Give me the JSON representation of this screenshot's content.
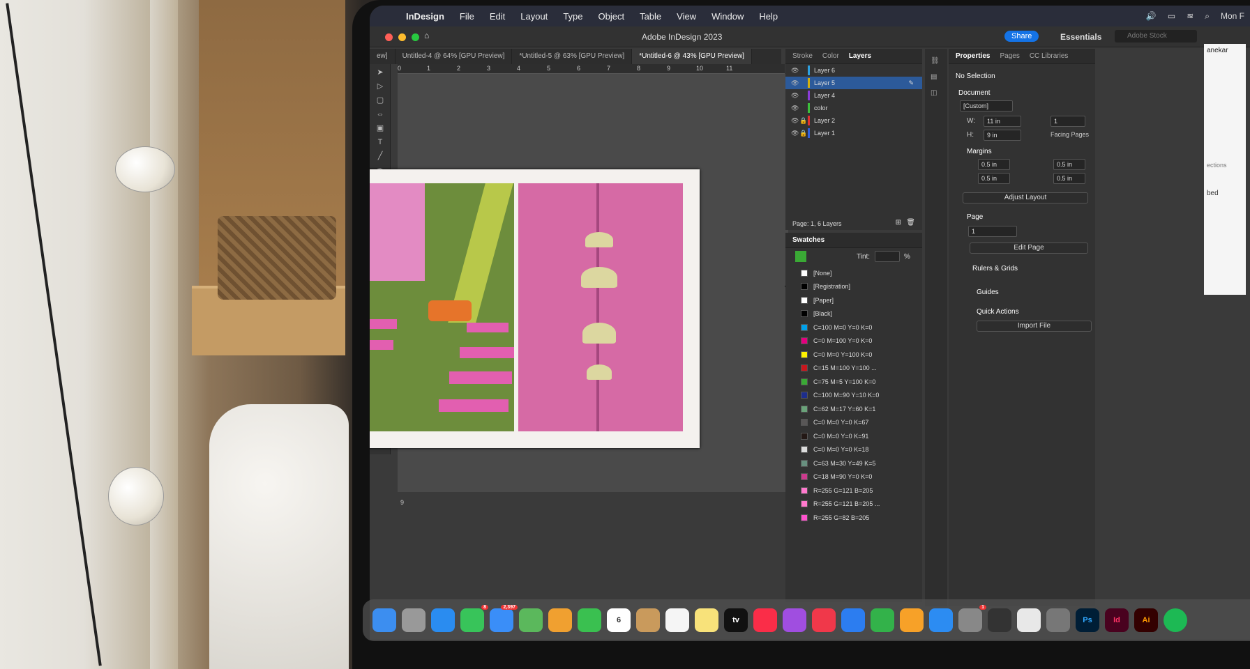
{
  "menubar": {
    "items": [
      "InDesign",
      "File",
      "Edit",
      "Layout",
      "Type",
      "Object",
      "Table",
      "View",
      "Window",
      "Help"
    ],
    "right": [
      "Mon F"
    ]
  },
  "window": {
    "title": "Adobe InDesign 2023",
    "share_label": "Share",
    "workspace_label": "Essentials",
    "stock_placeholder": "Adobe Stock"
  },
  "tabs": [
    {
      "label": "ew]"
    },
    {
      "label": "Untitled-4 @ 64% [GPU Preview]"
    },
    {
      "label": "*Untitled-5 @ 63% [GPU Preview]"
    },
    {
      "label": "*Untitled-6 @ 43% [GPU Preview]"
    }
  ],
  "ruler": {
    "ticks": [
      "0",
      "1",
      "2",
      "3",
      "4",
      "5",
      "6",
      "7",
      "8",
      "9",
      "10",
      "11"
    ],
    "side_label": "9"
  },
  "layers_panel": {
    "tabs": [
      "Stroke",
      "Color",
      "Layers"
    ],
    "layers": [
      {
        "name": "Layer 6",
        "color": "#2ea0e0"
      },
      {
        "name": "Layer 5",
        "color": "#d2b00f"
      },
      {
        "name": "Layer 4",
        "color": "#8a3cd6"
      },
      {
        "name": "color",
        "color": "#3cbf3c"
      },
      {
        "name": "Layer 2",
        "color": "#e03030"
      },
      {
        "name": "Layer 1",
        "color": "#3060e0"
      }
    ],
    "footer": "Page: 1, 6 Layers"
  },
  "swatches_panel": {
    "title": "Swatches",
    "tint_label": "Tint:",
    "tint_unit": "%",
    "swatches": [
      {
        "name": "[None]",
        "color": "#ffffff"
      },
      {
        "name": "[Registration]",
        "color": "#000000"
      },
      {
        "name": "[Paper]",
        "color": "#ffffff"
      },
      {
        "name": "[Black]",
        "color": "#000000"
      },
      {
        "name": "C=100 M=0 Y=0 K=0",
        "color": "#00a0e9"
      },
      {
        "name": "C=0 M=100 Y=0 K=0",
        "color": "#e4007f"
      },
      {
        "name": "C=0 M=0 Y=100 K=0",
        "color": "#fff100"
      },
      {
        "name": "C=15 M=100 Y=100 ...",
        "color": "#c8161d"
      },
      {
        "name": "C=75 M=5 Y=100 K=0",
        "color": "#3aa935"
      },
      {
        "name": "C=100 M=90 Y=10 K=0",
        "color": "#1d2d8c"
      },
      {
        "name": "C=62 M=17 Y=60 K=1",
        "color": "#6aa37a"
      },
      {
        "name": "C=0 M=0 Y=0 K=67",
        "color": "#595757"
      },
      {
        "name": "C=0 M=0 Y=0 K=91",
        "color": "#231815"
      },
      {
        "name": "C=0 M=0 Y=0 K=18",
        "color": "#dcdddd"
      },
      {
        "name": "C=63 M=30 Y=49 K=5",
        "color": "#68907f"
      },
      {
        "name": "C=18 M=90 Y=0 K=0",
        "color": "#cc3a8d"
      },
      {
        "name": "R=255 G=121 B=205",
        "color": "#ff79cd"
      },
      {
        "name": "R=255 G=121 B=205 ...",
        "color": "#ff79cd"
      },
      {
        "name": "R=255 G=82 B=205",
        "color": "#ff52cd"
      }
    ]
  },
  "properties_panel": {
    "tabs": [
      "Properties",
      "Pages",
      "CC Libraries"
    ],
    "selection": "No Selection",
    "document_label": "Document",
    "preset": "[Custom]",
    "width_label": "W:",
    "width": "11 in",
    "height_label": "H:",
    "height": "9 in",
    "pages_count": "1",
    "facing_pages": "Facing Pages",
    "margins_label": "Margins",
    "margin_top": "0.5 in",
    "margin_bottom": "0.5 in",
    "margin_left": "0.5 in",
    "margin_right": "0.5 in",
    "adjust_layout": "Adjust Layout",
    "page_label": "Page",
    "page_value": "1",
    "edit_page": "Edit Page",
    "rulers_grids": "Rulers & Grids",
    "guides": "Guides",
    "quick_actions": "Quick Actions",
    "import_file": "Import File"
  },
  "dock": {
    "apps": [
      {
        "name": "Finder",
        "color": "#3c8ef0"
      },
      {
        "name": "Launchpad",
        "color": "#999"
      },
      {
        "name": "Safari",
        "color": "#2a8cf0"
      },
      {
        "name": "Messages",
        "color": "#38c45a",
        "badge": "8"
      },
      {
        "name": "Mail",
        "color": "#3a8ef8",
        "badge": "2,397"
      },
      {
        "name": "Maps",
        "color": "#5bb85c"
      },
      {
        "name": "Photos",
        "color": "#f0a030"
      },
      {
        "name": "FaceTime",
        "color": "#3ac050"
      },
      {
        "name": "Calendar",
        "color": "#ffffff",
        "text": "6"
      },
      {
        "name": "Contacts",
        "color": "#c99a5c"
      },
      {
        "name": "Reminders",
        "color": "#f5f5f5"
      },
      {
        "name": "Notes",
        "color": "#f8e27a"
      },
      {
        "name": "TV",
        "color": "#111",
        "text": "tv"
      },
      {
        "name": "Music",
        "color": "#fa2d48"
      },
      {
        "name": "Podcasts",
        "color": "#a04ee0"
      },
      {
        "name": "News",
        "color": "#f0384a"
      },
      {
        "name": "Keynote",
        "color": "#2c7df0"
      },
      {
        "name": "Numbers",
        "color": "#33b24a"
      },
      {
        "name": "Pages",
        "color": "#f7a128"
      },
      {
        "name": "App Store",
        "color": "#2c8cf2"
      },
      {
        "name": "System Settings",
        "color": "#888",
        "badge": "1"
      },
      {
        "name": "Activity",
        "color": "#333"
      },
      {
        "name": "Chrome",
        "color": "#e8e8e8"
      },
      {
        "name": "Screenshot",
        "color": "#777"
      },
      {
        "name": "Photoshop",
        "color": "#001e36",
        "text": "Ps"
      },
      {
        "name": "InDesign",
        "color": "#49021f",
        "text": "Id"
      },
      {
        "name": "Illustrator",
        "color": "#330000",
        "text": "Ai"
      },
      {
        "name": "Spotify",
        "color": "#1db954"
      }
    ]
  },
  "right_window": {
    "lines": [
      "anekar",
      "ections",
      "bed"
    ]
  }
}
